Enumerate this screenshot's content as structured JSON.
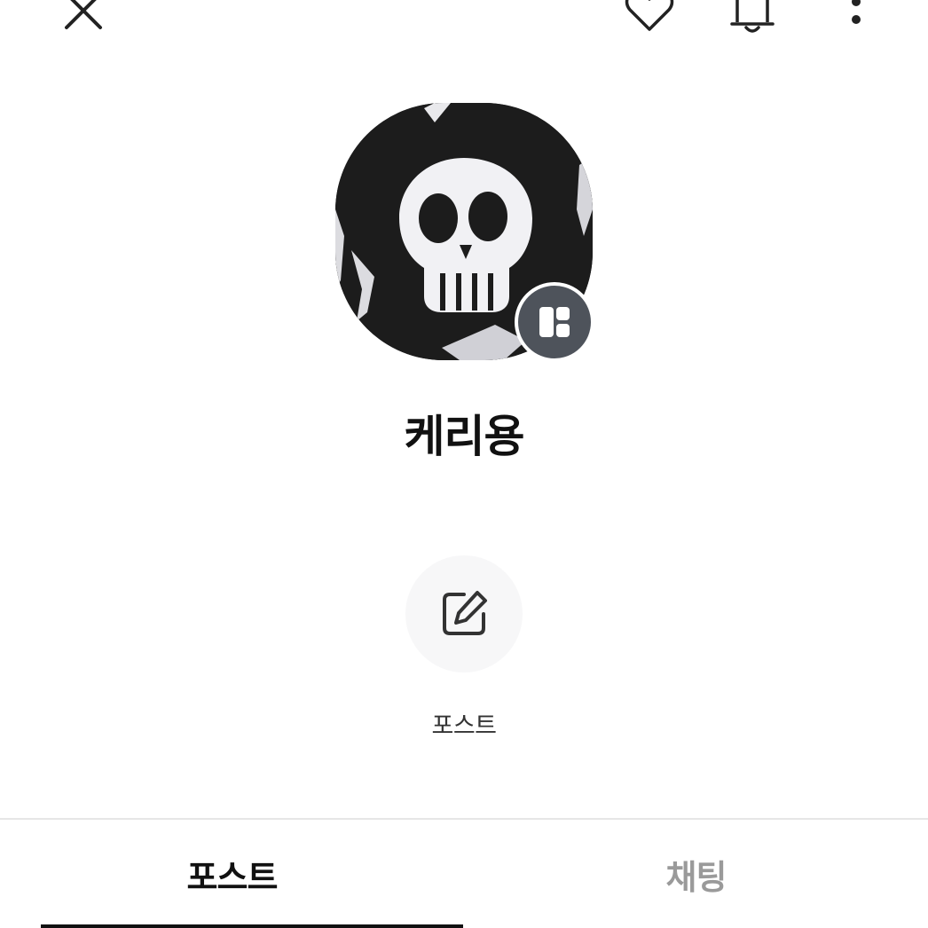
{
  "topbar": {
    "close_icon": "close-icon",
    "like_icon": "heart-icon",
    "notification_icon": "bell-icon",
    "more_icon": "more-vertical-icon"
  },
  "profile": {
    "name": "케리용",
    "avatar_icon": "skull-avatar-image",
    "badge_icon": "profile-type-badge-icon",
    "badge_color": "#4e535b"
  },
  "actions": [
    {
      "label": "포스트",
      "icon": "edit-pencil-icon"
    }
  ],
  "tabs": [
    {
      "label": "포스트",
      "active": true
    },
    {
      "label": "채팅",
      "active": false
    }
  ],
  "colors": {
    "active_tab": "#111111",
    "inactive_tab": "#9a9a9a",
    "action_circle": "#f7f7f8"
  }
}
